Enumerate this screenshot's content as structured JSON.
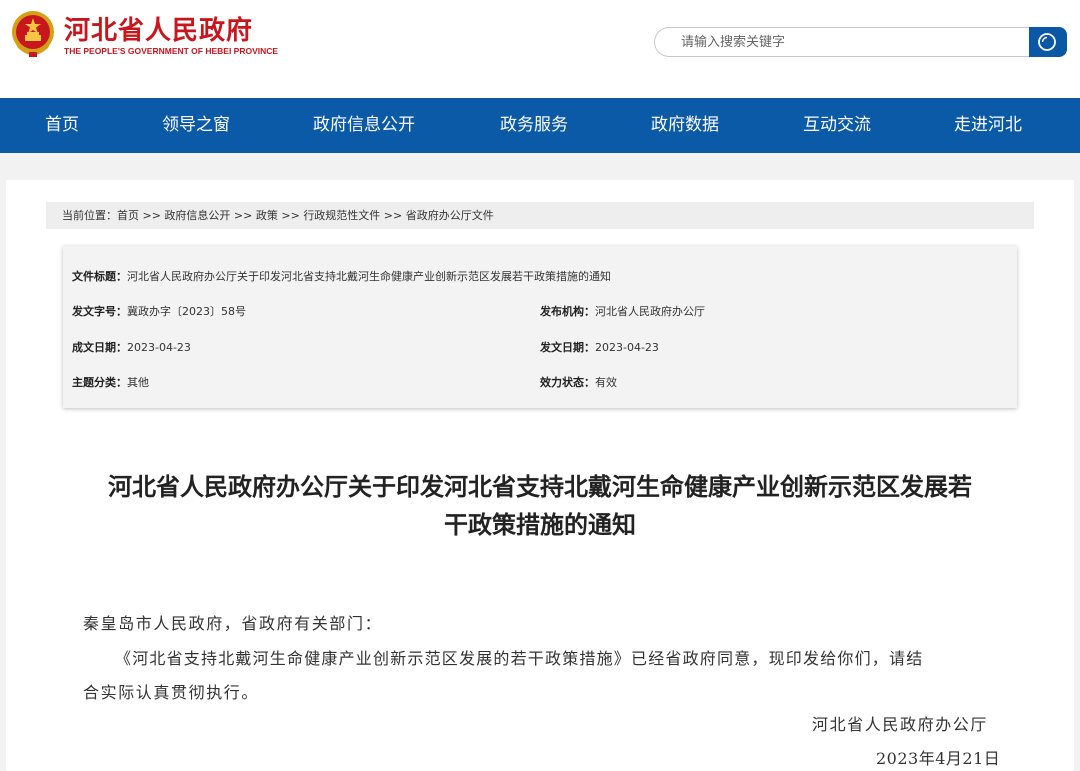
{
  "header": {
    "site_title": "河北省人民政府",
    "site_subtitle": "THE PEOPLE'S GOVERNMENT OF HEBEI PROVINCE",
    "search_placeholder": "请输入搜索关键字"
  },
  "nav": {
    "items": [
      "首页",
      "领导之窗",
      "政府信息公开",
      "政务服务",
      "政府数据",
      "互动交流",
      "走进河北"
    ]
  },
  "breadcrumb": {
    "prefix": "当前位置：",
    "items": [
      "首页",
      "政府信息公开",
      "政策",
      "行政规范性文件",
      "省政府办公厅文件"
    ],
    "separator": " >> "
  },
  "info": {
    "title_label": "文件标题：",
    "title_value": "河北省人民政府办公厅关于印发河北省支持北戴河生命健康产业创新示范区发展若干政策措施的通知",
    "doc_no_label": "发文字号：",
    "doc_no_value": "冀政办字〔2023〕58号",
    "issuer_label": "发布机构：",
    "issuer_value": "河北省人民政府办公厅",
    "written_date_label": "成文日期：",
    "written_date_value": "2023-04-23",
    "issue_date_label": "发文日期：",
    "issue_date_value": "2023-04-23",
    "category_label": "主题分类：",
    "category_value": "其他",
    "status_label": "效力状态：",
    "status_value": "有效"
  },
  "document": {
    "title_line1": "河北省人民政府办公厅关于印发河北省支持北戴河生命健康产业创新示范区发展若",
    "title_line2": "干政策措施的通知",
    "salutation": "秦皇岛市人民政府，省政府有关部门：",
    "body_line1": "《河北省支持北戴河生命健康产业创新示范区发展的若干政策措施》已经省政府同意，现印发给你们，请结",
    "body_line2": "合实际认真贯彻执行。",
    "signature": "河北省人民政府办公厅",
    "date": "2023年4月21日"
  },
  "colors": {
    "brand_red": "#c8161d",
    "nav_blue": "#0b5aa8",
    "search_blue": "#0a57a5"
  }
}
